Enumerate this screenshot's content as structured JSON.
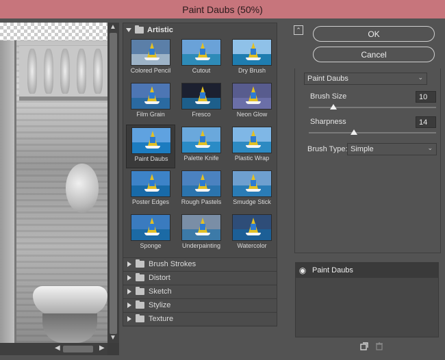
{
  "window": {
    "title": "Paint Daubs (50%)"
  },
  "gallery": {
    "expanded_category": "Artistic",
    "filters": [
      {
        "label": "Colored Pencil",
        "sky": "#5b7fa8",
        "sea": "#9db3c7"
      },
      {
        "label": "Cutout",
        "sky": "#6aa2d8",
        "sea": "#2e8bb8"
      },
      {
        "label": "Dry Brush",
        "sky": "#8fc1e8",
        "sea": "#1f7db0"
      },
      {
        "label": "Film Grain",
        "sky": "#4d76b4",
        "sea": "#2a6aa1"
      },
      {
        "label": "Fresco",
        "sky": "#1c2030",
        "sea": "#1d5f8b"
      },
      {
        "label": "Neon Glow",
        "sky": "#585c8e",
        "sea": "#6b6fa8"
      },
      {
        "label": "Paint Daubs",
        "sky": "#5fa2e0",
        "sea": "#1c7cc0"
      },
      {
        "label": "Palette Knife",
        "sky": "#6aa8dc",
        "sea": "#2a8bc6"
      },
      {
        "label": "Plastic Wrap",
        "sky": "#7fb7e6",
        "sea": "#2d8ac2"
      },
      {
        "label": "Poster Edges",
        "sky": "#3d83c8",
        "sea": "#186aa8"
      },
      {
        "label": "Rough Pastels",
        "sky": "#4b82c0",
        "sea": "#2b74ae"
      },
      {
        "label": "Smudge Stick",
        "sky": "#6e9fcf",
        "sea": "#2a7cb6"
      },
      {
        "label": "Sponge",
        "sky": "#3a7bbf",
        "sea": "#1b6aa5"
      },
      {
        "label": "Underpainting",
        "sky": "#7a8ea6",
        "sea": "#3c7aa8"
      },
      {
        "label": "Watercolor",
        "sky": "#2e4d78",
        "sea": "#1c5f96"
      }
    ],
    "categories": [
      "Brush Strokes",
      "Distort",
      "Sketch",
      "Stylize",
      "Texture"
    ]
  },
  "buttons": {
    "ok": "OK",
    "cancel": "Cancel"
  },
  "settings": {
    "filter_select": "Paint Daubs",
    "brush_size_label": "Brush Size",
    "brush_size_value": "10",
    "sharpness_label": "Sharpness",
    "sharpness_value": "14",
    "brush_type_label": "Brush Type:",
    "brush_type_value": "Simple"
  },
  "layers": {
    "items": [
      {
        "name": "Paint Daubs",
        "visible": true
      }
    ]
  },
  "icons": {
    "collapse": "collapse-panel-icon",
    "new_layer": "new-effect-layer-icon",
    "delete": "trash-icon",
    "eye": "eye-icon"
  }
}
